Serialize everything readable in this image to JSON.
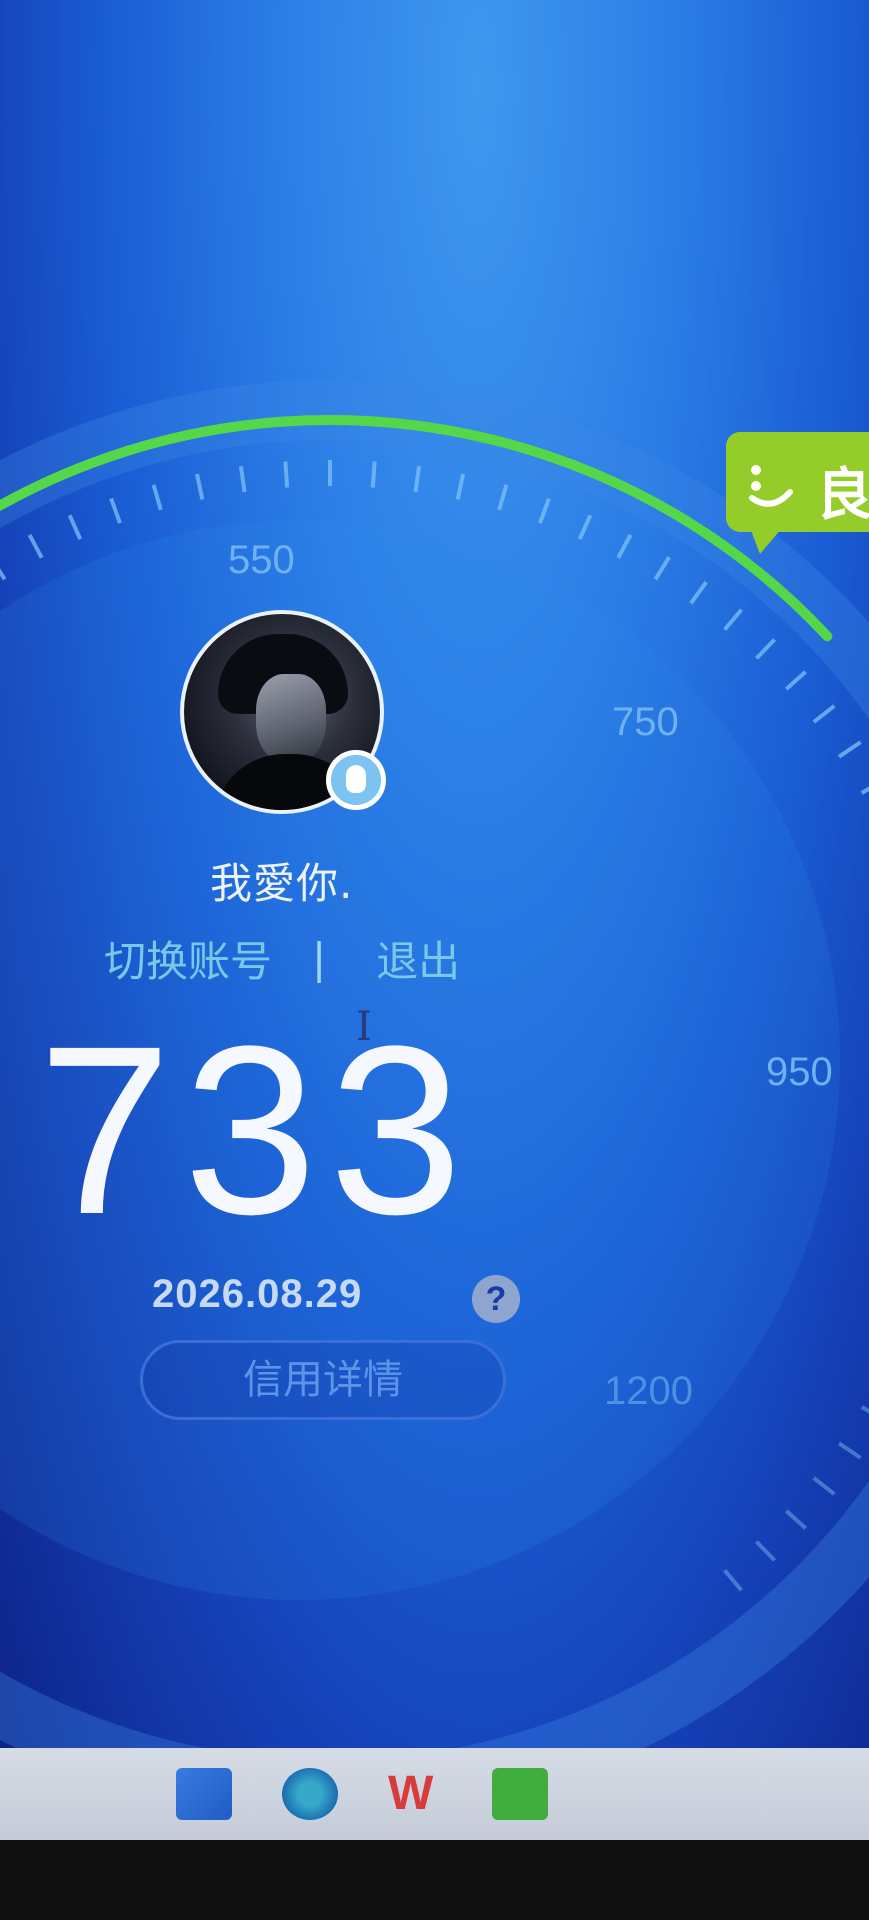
{
  "dial": {
    "tick_labels": [
      "550",
      "750",
      "950",
      "1200"
    ]
  },
  "profile": {
    "nickname": "我愛你.",
    "switch_account": "切换账号",
    "separator": "|",
    "logout": "退出"
  },
  "score": {
    "value": "733",
    "date": "2026.08.29",
    "help": "?",
    "detail_button": "信用详情",
    "status": "良"
  },
  "taskbar": {
    "apps": [
      "windows-start",
      "edge",
      "office",
      "wechat"
    ],
    "office_glyph": "W"
  },
  "colors": {
    "arc": "#54d84a",
    "status_tag": "#94cc2a",
    "link": "#79c8ea",
    "score": "#f6f8ff"
  }
}
